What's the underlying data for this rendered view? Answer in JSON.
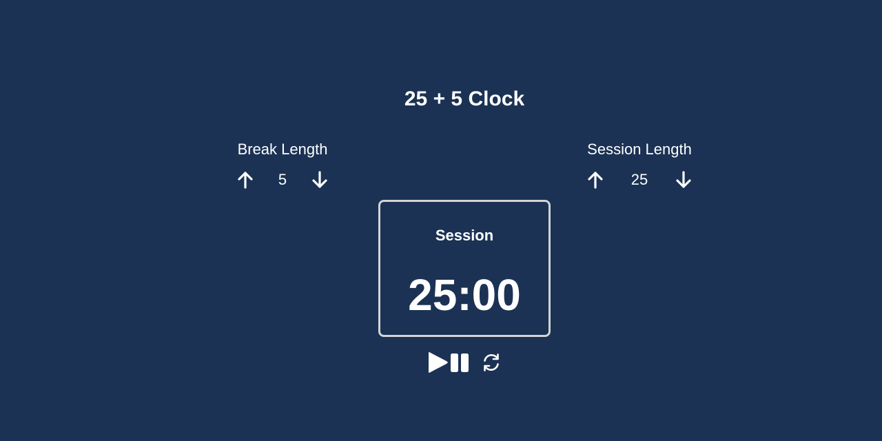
{
  "app": {
    "title": "25 + 5 Clock"
  },
  "break": {
    "label": "Break Length",
    "value": "5",
    "increment_icon": "arrow-up-icon",
    "decrement_icon": "arrow-down-icon"
  },
  "session": {
    "label": "Session Length",
    "value": "25",
    "increment_icon": "arrow-up-icon",
    "decrement_icon": "arrow-down-icon"
  },
  "timer": {
    "label": "Session",
    "time_left": "25:00"
  },
  "controls": {
    "start_stop_icon": "play-pause-icon",
    "reset_icon": "refresh-icon"
  },
  "colors": {
    "background": "#1b3254",
    "text": "#ffffff",
    "timer_border": "#d4d4d4"
  }
}
